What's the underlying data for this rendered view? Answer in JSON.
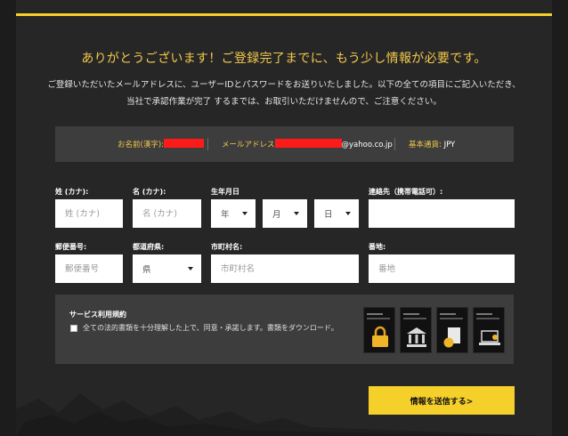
{
  "header": {
    "title": "ありがとうございます！ご登録完了までに、もう少し情報が必要です。",
    "desc_line1": "ご登録いただいたメールアドレスに、ユーザーIDとパスワードをお送りいたしました。以下の全ての項目にご記入いただき、",
    "desc_line2": "当社で承認作業が完了 するまでは、お取引いただけませんので、ご注意ください。"
  },
  "info": {
    "name_label": "お名前(漢字):",
    "email_label": "メールアドレス",
    "email_suffix": "@yahoo.co.jp",
    "currency_label": "基本通貨:",
    "currency_value": "JPY"
  },
  "form": {
    "last_kana_label": "姓 (カナ):",
    "last_kana_placeholder": "姓 (カナ)",
    "first_kana_label": "名 (カナ):",
    "first_kana_placeholder": "名 (カナ)",
    "dob_label": "生年月日",
    "year_value": "年",
    "month_value": "月",
    "day_value": "日",
    "phone_label": "連絡先（携帯電話可）:",
    "phone_placeholder": "",
    "zip_label": "郵便番号:",
    "zip_placeholder": "郵便番号",
    "pref_label": "都道府県:",
    "pref_value": "県",
    "city_label": "市町村名:",
    "city_placeholder": "市町村名",
    "address_label": "番地:",
    "address_placeholder": "番地"
  },
  "terms": {
    "title": "サービス利用規約",
    "checkbox_text": "全ての法的書類を十分理解した上で、同意・承諾します。書類をダウンロード。",
    "thumbnail_icons": [
      "padlock-icon",
      "bank-icon",
      "document-coin-icon",
      "laptop-icon"
    ]
  },
  "submit_label": "情報を送信する>",
  "colors": {
    "accent": "#f5cf2a",
    "heading": "#f2c94c",
    "panel": "#3d3d3d",
    "background": "#262626",
    "redaction": "#ff1a1a"
  }
}
